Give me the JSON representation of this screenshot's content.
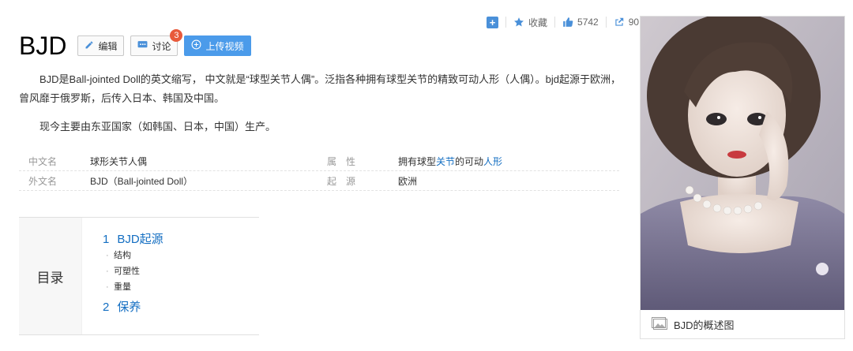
{
  "top_actions": {
    "plus_label": "+",
    "favorite_label": "收藏",
    "likes_count": "5742",
    "shares_count": "90"
  },
  "title": "BJD",
  "buttons": {
    "edit_label": "编辑",
    "discuss_label": "讨论",
    "discuss_badge": "3",
    "upload_video_label": "上传视频"
  },
  "intro": {
    "paragraph1": "BJD是Ball-jointed Doll的英文缩写， 中文就是“球型关节人偶”。泛指各种拥有球型关节的精致可动人形（人偶）。bjd起源于欧洲，曾风靡于俄罗斯，后传入日本、韩国及中国。",
    "paragraph2": "现今主要由东亚国家（如韩国、日本，中国）生产。"
  },
  "info": {
    "row1": {
      "key1": "中文名",
      "value1": "球形关节人偶",
      "key2": "属　性",
      "value2_prefix": "拥有球型",
      "value2_link1": "关节",
      "value2_mid": "的可动",
      "value2_link2": "人形"
    },
    "row2": {
      "key1": "外文名",
      "value1": "BJD（Ball-jointed Doll）",
      "key2": "起　源",
      "value2": "欧洲"
    }
  },
  "toc": {
    "label": "目录",
    "items": [
      {
        "num": "1",
        "title": "BJD起源",
        "subs": [
          "结构",
          "可塑性",
          "重量"
        ]
      },
      {
        "num": "2",
        "title": "保养"
      }
    ]
  },
  "summary_pic": {
    "caption": "BJD的概述图"
  },
  "colors": {
    "accent_blue": "#4b9bea",
    "link_blue": "#136ec2",
    "badge_red": "#e85a3b"
  }
}
